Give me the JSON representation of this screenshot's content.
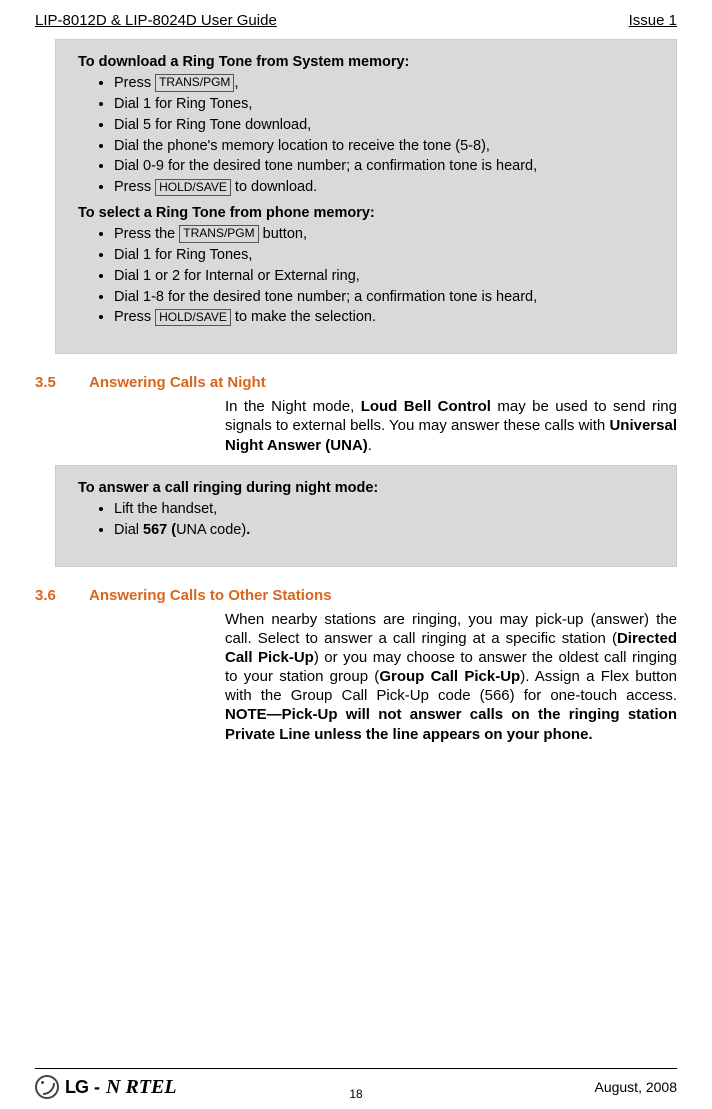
{
  "header": {
    "left": "LIP-8012D & LIP-8024D User Guide",
    "right": "Issue 1"
  },
  "box1": {
    "heading1": "To download a Ring Tone from System memory:",
    "items1": {
      "i0a": "Press ",
      "i0key": "TRANS/PGM",
      "i0b": ",",
      "i1": "Dial 1 for Ring Tones,",
      "i2": "Dial 5 for Ring Tone download,",
      "i3": "Dial the phone's memory location to receive the tone (5-8),",
      "i4": "Dial 0-9 for the desired tone number; a confirmation tone is heard,",
      "i5a": "Press ",
      "i5key": "HOLD/SAVE",
      "i5b": " to download."
    },
    "heading2": "To select a Ring Tone from phone memory:",
    "items2": {
      "i0a": "Press the ",
      "i0key": "TRANS/PGM",
      "i0b": " button,",
      "i1": "Dial 1 for Ring Tones,",
      "i2": "Dial 1 or 2 for Internal or External ring,",
      "i3": "Dial 1-8 for the desired tone number; a confirmation tone is heard,",
      "i4a": "Press ",
      "i4key": "HOLD/SAVE",
      "i4b": " to make the selection."
    }
  },
  "section35": {
    "num": "3.5",
    "title": "Answering Calls at Night",
    "body_a": "In the Night mode, ",
    "body_b": "Loud Bell Control",
    "body_c": " may be used to send ring signals to external bells.  You may answer these calls with ",
    "body_d": "Universal Night Answer (UNA)",
    "body_e": "."
  },
  "box2": {
    "heading": "To answer a call ringing during night mode:",
    "i0": "Lift the handset,",
    "i1a": "Dial ",
    "i1b": "567 (",
    "i1c": "UNA code)",
    "i1d": "."
  },
  "section36": {
    "num": "3.6",
    "title": "Answering Calls to Other Stations",
    "body_a": "When nearby stations are ringing, you may pick-up (answer) the call.  Select to answer a call ringing at a specific station (",
    "body_b": "Directed Call Pick-Up",
    "body_c": ") or you may choose to answer the oldest call ringing to your station group (",
    "body_d": "Group Call Pick-Up",
    "body_e": ").  Assign a Flex button with the Group Call Pick-Up code (566) for one-touch access. ",
    "body_f": "NOTE—Pick-Up will not answer calls on the ringing station Private Line unless the line appears on your phone."
  },
  "footer": {
    "logo_lg": "LG",
    "logo_nortel": "N   RTEL",
    "page": "18",
    "date": "August, 2008"
  }
}
